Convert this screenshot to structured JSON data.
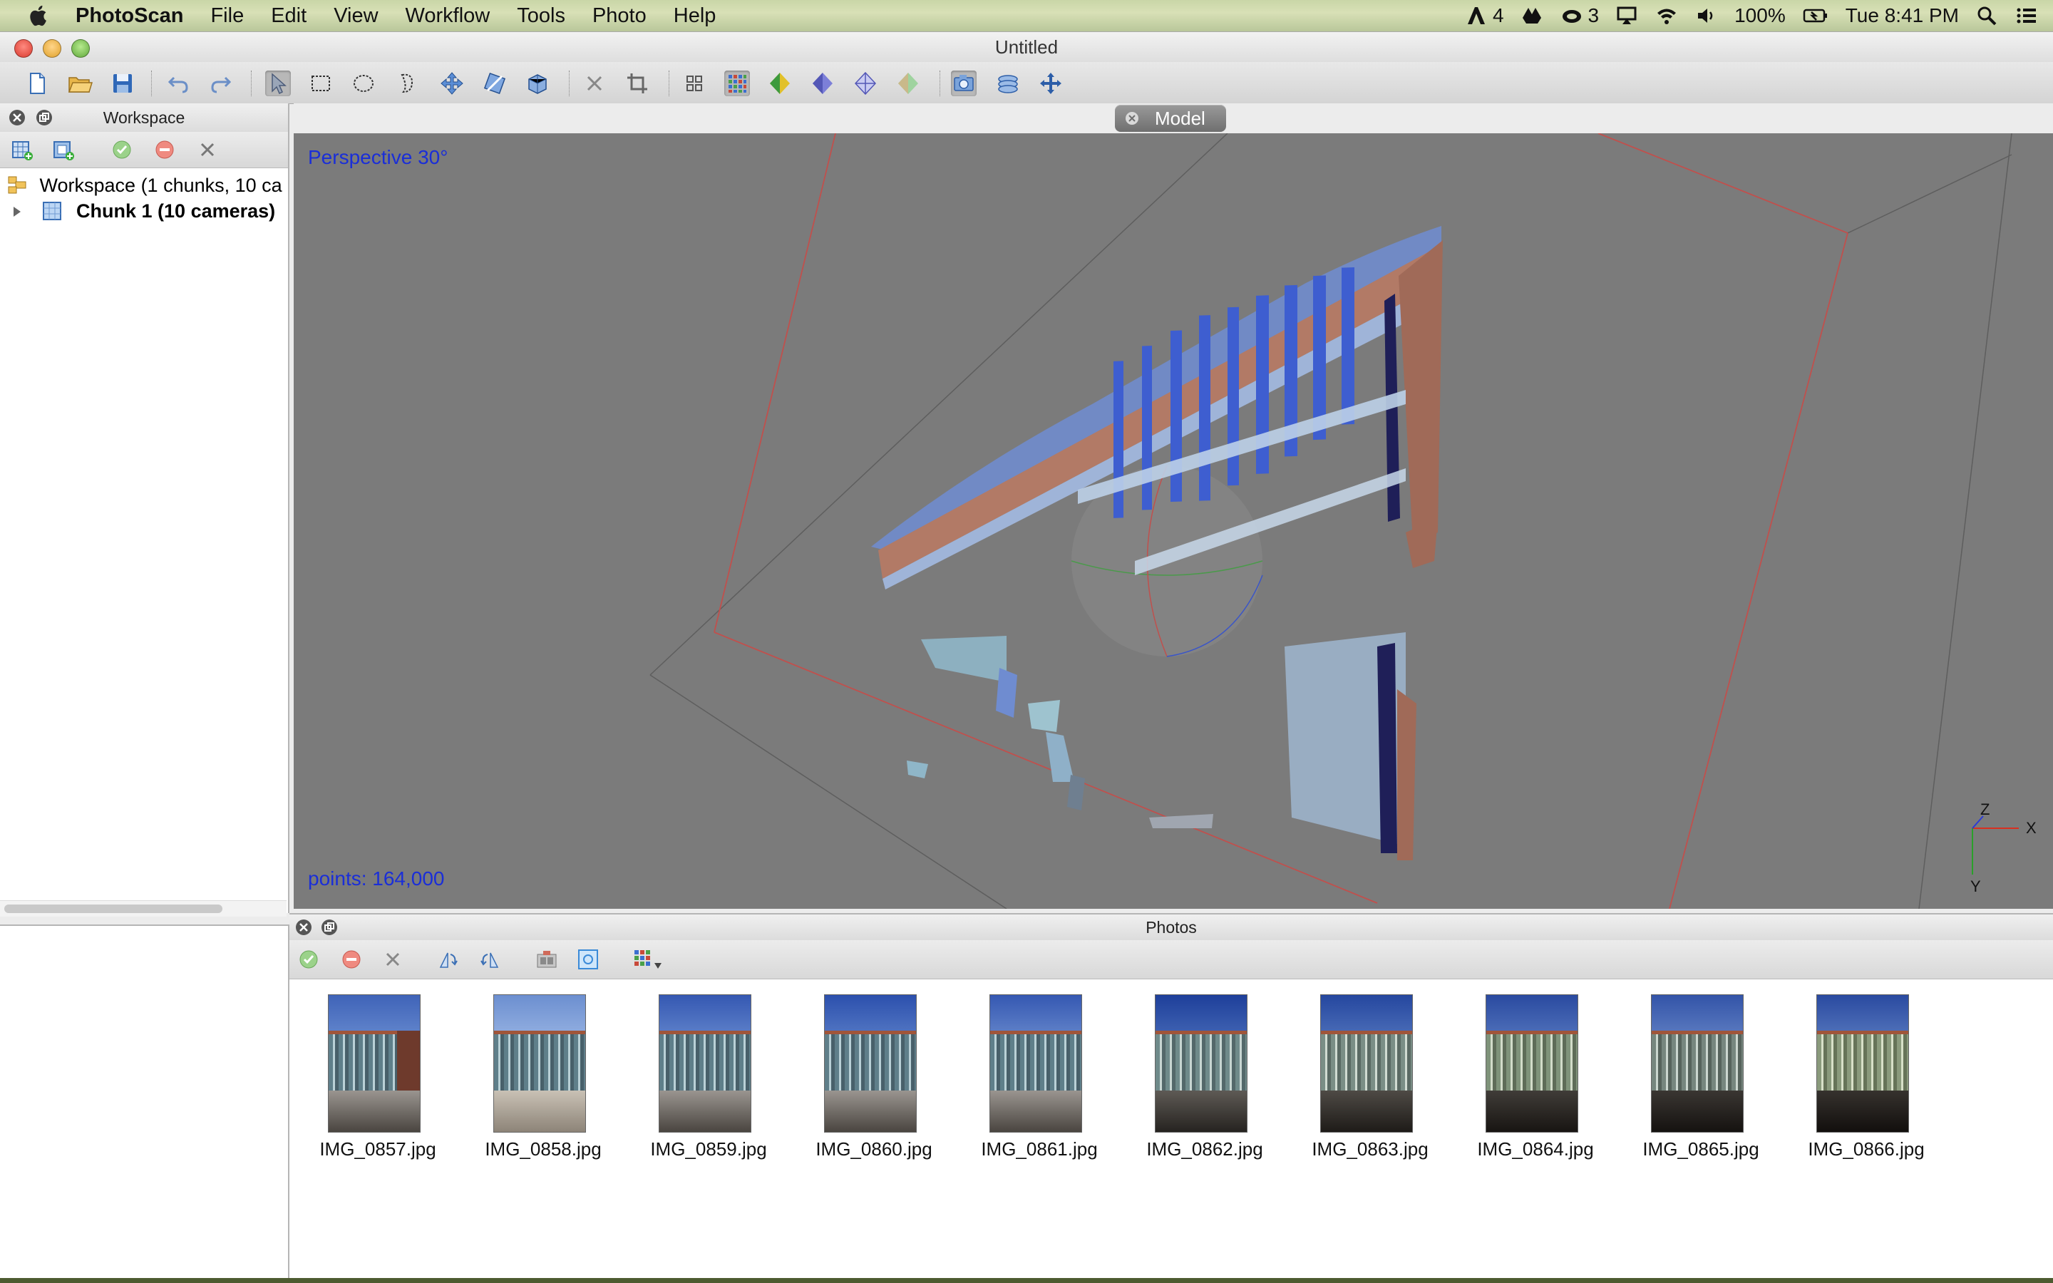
{
  "menubar": {
    "app_name": "PhotoScan",
    "menus": [
      "File",
      "Edit",
      "View",
      "Workflow",
      "Tools",
      "Photo",
      "Help"
    ],
    "status": {
      "adobe_count": "4",
      "cc_count": "3",
      "battery": "100%",
      "clock": "Tue 8:41 PM"
    }
  },
  "window": {
    "title": "Untitled"
  },
  "workspace": {
    "title": "Workspace",
    "root_label": "Workspace (1 chunks, 10 ca",
    "chunk_label": "Chunk 1 (10 cameras)"
  },
  "model": {
    "tab_label": "Model",
    "perspective": "Perspective 30°",
    "points": "points: 164,000",
    "axes": {
      "z": "Z",
      "x": "X",
      "y": "Y"
    }
  },
  "photos": {
    "title": "Photos",
    "items": [
      "IMG_0857.jpg",
      "IMG_0858.jpg",
      "IMG_0859.jpg",
      "IMG_0860.jpg",
      "IMG_0861.jpg",
      "IMG_0862.jpg",
      "IMG_0863.jpg",
      "IMG_0864.jpg",
      "IMG_0865.jpg",
      "IMG_0866.jpg"
    ]
  },
  "colors": {
    "viewport_bg": "#7b7b7b",
    "overlay_text": "#1a2ed8",
    "bbox_red": "#c0504d"
  },
  "icons": [
    "apple-icon",
    "new-icon",
    "open-icon",
    "save-icon",
    "undo-icon",
    "redo-icon",
    "select-icon",
    "rect-select-icon",
    "ellipse-select-icon",
    "free-select-icon",
    "navigation-icon",
    "rotate-icon",
    "move-region-icon",
    "delete-icon",
    "crop-icon",
    "point-cloud-icon",
    "dense-cloud-icon",
    "shaded-icon",
    "solid-icon",
    "wireframe-icon",
    "textured-icon",
    "cameras-icon",
    "reset-view-icon",
    "move-object-icon"
  ]
}
